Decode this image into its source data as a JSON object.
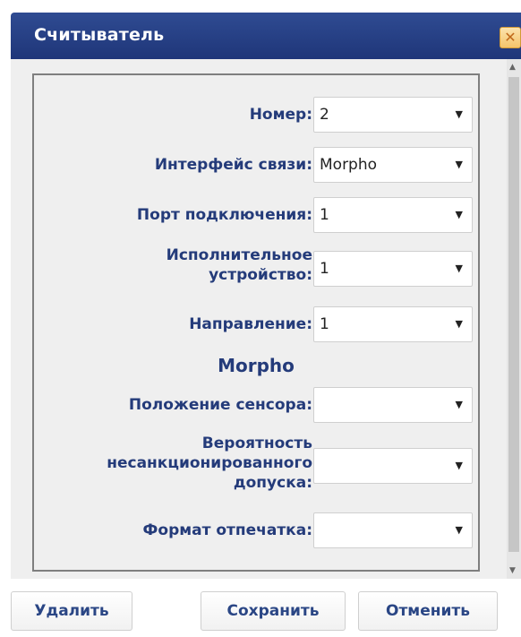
{
  "dialog": {
    "title": "Считыватель",
    "close_icon": "close-icon"
  },
  "form": {
    "number": {
      "label": "Номер:",
      "value": "2"
    },
    "interface": {
      "label": "Интерфейс связи:",
      "value": "Morpho"
    },
    "port": {
      "label": "Порт подключения:",
      "value": "1"
    },
    "executive_device": {
      "label_line1": "Исполнительное",
      "label_line2": "устройство:",
      "value": "1"
    },
    "direction": {
      "label": "Направление:",
      "value": "1"
    },
    "section_title": "Morpho",
    "sensor_position": {
      "label": "Положение сенсора:",
      "value": ""
    },
    "far": {
      "label_line1": "Вероятность",
      "label_line2": "несанкционированного",
      "label_line3": "допуска:",
      "value": ""
    },
    "print_format": {
      "label": "Формат отпечатка:",
      "value": ""
    }
  },
  "buttons": {
    "delete": "Удалить",
    "save": "Сохранить",
    "cancel": "Отменить"
  },
  "colors": {
    "titlebar": "#2f4b92",
    "label": "#243b7a",
    "close_button": "#f4c46a"
  }
}
